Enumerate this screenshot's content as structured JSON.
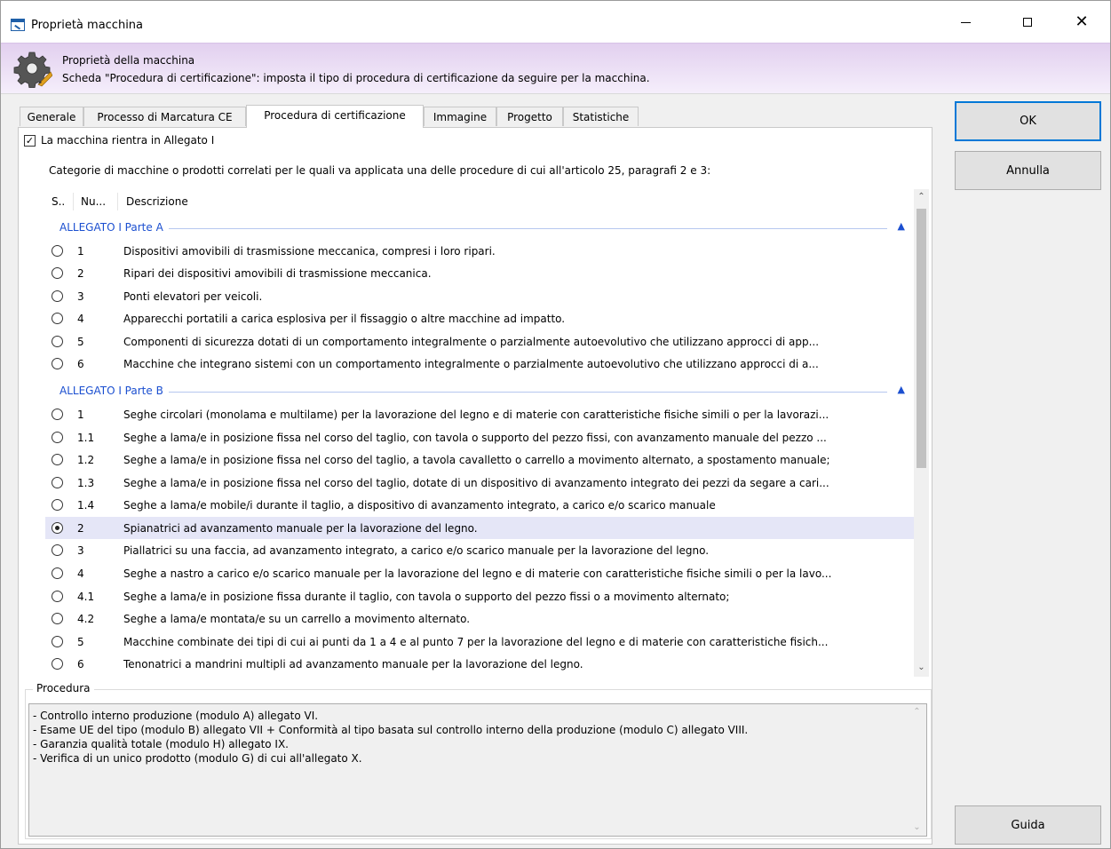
{
  "window": {
    "title": "Proprietà macchina",
    "controls": {
      "minimize": "—",
      "maximize": "☐",
      "close": "✕"
    }
  },
  "header": {
    "title": "Proprietà della macchina",
    "subtitle": "Scheda \"Procedura di certificazione\": imposta il tipo di procedura di certificazione da seguire per la macchina.",
    "icon": "gear-icon"
  },
  "tabs": [
    {
      "label": "Generale"
    },
    {
      "label": "Processo di Marcatura CE"
    },
    {
      "label": "Procedura di certificazione",
      "active": true
    },
    {
      "label": "Immagine"
    },
    {
      "label": "Progetto"
    },
    {
      "label": "Statistiche"
    }
  ],
  "checkbox": {
    "label": "La macchina rientra in Allegato I",
    "checked": true
  },
  "intro": "Categorie di macchine o prodotti correlati per le quali va applicata una delle procedure di cui all'articolo 25, paragrafi 2 e 3:",
  "list": {
    "columns": [
      "S..",
      "Nu...",
      "Descrizione"
    ],
    "groups": [
      {
        "title": "ALLEGATO I Parte A",
        "items": [
          {
            "num": "1",
            "desc": "Dispositivi amovibili di trasmissione meccanica, compresi i loro ripari.",
            "selected": false
          },
          {
            "num": "2",
            "desc": "Ripari dei dispositivi amovibili di trasmissione meccanica.",
            "selected": false
          },
          {
            "num": "3",
            "desc": "Ponti elevatori per veicoli.",
            "selected": false
          },
          {
            "num": "4",
            "desc": "Apparecchi portatili a carica esplosiva per il fissaggio o altre macchine ad impatto.",
            "selected": false
          },
          {
            "num": "5",
            "desc": "Componenti di sicurezza dotati di un comportamento integralmente o parzialmente autoevolutivo che utilizzano approcci di app...",
            "selected": false
          },
          {
            "num": "6",
            "desc": "Macchine che integrano sistemi con un comportamento integralmente o parzialmente autoevolutivo che utilizzano approcci di a...",
            "selected": false
          }
        ]
      },
      {
        "title": "ALLEGATO I Parte B",
        "items": [
          {
            "num": "1",
            "desc": "Seghe circolari (monolama e multilame) per la lavorazione del legno e di materie con caratteristiche fisiche simili o per la lavorazi...",
            "selected": false
          },
          {
            "num": "1.1",
            "desc": "Seghe a lama/e in posizione fissa nel corso del taglio, con tavola o supporto del pezzo fissi, con avanzamento manuale del pezzo ...",
            "selected": false
          },
          {
            "num": "1.2",
            "desc": "Seghe a lama/e in posizione fissa nel corso del taglio, a tavola cavalletto o carrello a movimento alternato, a spostamento manuale;",
            "selected": false
          },
          {
            "num": "1.3",
            "desc": "Seghe a lama/e in posizione fissa nel corso del taglio, dotate di un dispositivo di avanzamento integrato dei pezzi da segare a cari...",
            "selected": false
          },
          {
            "num": "1.4",
            "desc": "Seghe a lama/e mobile/i durante il taglio, a dispositivo di avanzamento integrato, a carico e/o scarico manuale",
            "selected": false
          },
          {
            "num": "2",
            "desc": "Spianatrici ad avanzamento manuale per la lavorazione del legno.",
            "selected": true
          },
          {
            "num": "3",
            "desc": "Piallatrici su una faccia, ad avanzamento integrato, a carico e/o scarico manuale per la lavorazione del legno.",
            "selected": false
          },
          {
            "num": "4",
            "desc": "Seghe a nastro a carico e/o scarico manuale per la lavorazione del legno e di materie con caratteristiche fisiche simili o per la lavo...",
            "selected": false
          },
          {
            "num": "4.1",
            "desc": "Seghe a lama/e in posizione fissa durante il taglio, con tavola o supporto del pezzo fissi o a movimento alternato;",
            "selected": false
          },
          {
            "num": "4.2",
            "desc": "Seghe a lama/e montata/e su un carrello a movimento alternato.",
            "selected": false
          },
          {
            "num": "5",
            "desc": "Macchine combinate dei tipi di cui ai punti da 1 a 4 e al punto 7 per la lavorazione del legno e di materie con caratteristiche fisich...",
            "selected": false
          },
          {
            "num": "6",
            "desc": "Tenonatrici a mandrini multipli ad avanzamento manuale per la lavorazione del legno.",
            "selected": false
          }
        ]
      }
    ]
  },
  "procedure": {
    "label": "Procedura",
    "lines": [
      "- Controllo interno produzione (modulo A) allegato VI.",
      "- Esame UE del tipo (modulo B) allegato VII + Conformità al tipo basata sul controllo interno della produzione (modulo C) allegato VIII.",
      "- Garanzia qualità totale (modulo H) allegato IX.",
      "- Verifica di un unico prodotto (modulo G) di cui all'allegato X."
    ]
  },
  "buttons": {
    "ok": "OK",
    "cancel": "Annulla",
    "help": "Guida"
  },
  "colors": {
    "accent": "#0078d7",
    "group_title": "#1b4fd0",
    "selected_row": "#e5e6f7",
    "header_band": "#e2d0ef"
  }
}
